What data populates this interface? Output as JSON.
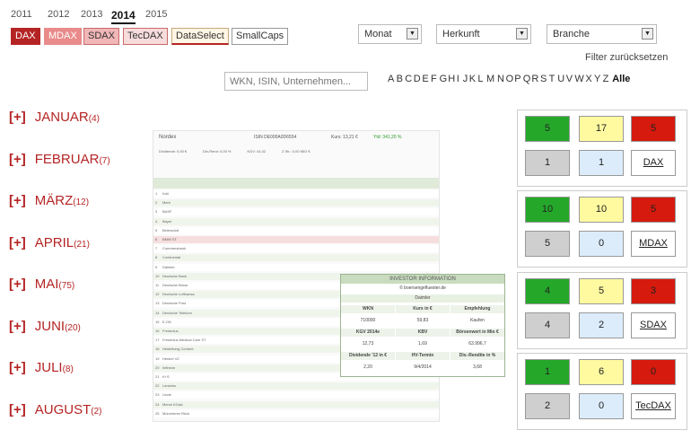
{
  "years": [
    "2011",
    "2012",
    "2013",
    "2014",
    "2015"
  ],
  "active_year": "2014",
  "indices": [
    {
      "label": "DAX",
      "bg": "#b52424",
      "fg": "#ffffff",
      "border": "#b52424"
    },
    {
      "label": "MDAX",
      "bg": "#e98b8b",
      "fg": "#ffffff",
      "border": "#e98b8b"
    },
    {
      "label": "SDAX",
      "bg": "#f1b6b6",
      "fg": "#333333",
      "border": "#c86a6a"
    },
    {
      "label": "TecDAX",
      "bg": "#f8dcdc",
      "fg": "#333333",
      "border": "#c86a6a"
    },
    {
      "label": "DataSelect",
      "bg": "#fff6e5",
      "fg": "#333333",
      "border": "#c9a77a"
    },
    {
      "label": "SmallCaps",
      "bg": "#ffffff",
      "fg": "#333333",
      "border": "#999999"
    }
  ],
  "filters": {
    "monat": "Monat",
    "herkunft": "Herkunft",
    "branche": "Branche",
    "reset": "Filter zurücksetzen",
    "search_placeholder": "WKN, ISIN, Unternehmen...",
    "letters": [
      "A",
      "B",
      "C",
      "D",
      "E",
      "F",
      "G",
      "H",
      "I",
      "J",
      "K",
      "L",
      "M",
      "N",
      "O",
      "P",
      "Q",
      "R",
      "S",
      "T",
      "U",
      "V",
      "W",
      "X",
      "Y",
      "Z"
    ],
    "all_label": "Alle"
  },
  "months": [
    {
      "plus": "[+]",
      "name": "JANUAR",
      "count": "(4)"
    },
    {
      "plus": "[+]",
      "name": "FEBRUAR",
      "count": "(7)"
    },
    {
      "plus": "[+]",
      "name": "MÄRZ",
      "count": "(12)"
    },
    {
      "plus": "[+]",
      "name": "APRIL",
      "count": "(21)"
    },
    {
      "plus": "[+]",
      "name": "MAI",
      "count": "(75)"
    },
    {
      "plus": "[+]",
      "name": "JUNI",
      "count": "(20)"
    },
    {
      "plus": "[+]",
      "name": "JULI",
      "count": "(8)"
    },
    {
      "plus": "[+]",
      "name": "AUGUST",
      "count": "(2)"
    }
  ],
  "panels": [
    {
      "green": "5",
      "yellow": "17",
      "red": "5",
      "gray": "1",
      "blue": "1",
      "label": "DAX"
    },
    {
      "green": "10",
      "yellow": "10",
      "red": "5",
      "gray": "5",
      "blue": "0",
      "label": "MDAX"
    },
    {
      "green": "4",
      "yellow": "5",
      "red": "3",
      "gray": "4",
      "blue": "2",
      "label": "SDAX"
    },
    {
      "green": "1",
      "yellow": "6",
      "red": "0",
      "gray": "2",
      "blue": "0",
      "label": "TecDAX"
    }
  ],
  "colors": {
    "green": "#25a82a",
    "yellow": "#fffaa0",
    "red": "#d61a0e",
    "gray": "#cfcfcf",
    "blue": "#dcecfb",
    "accent": "#b52424"
  },
  "preview": {
    "company": "Nordex",
    "isin": "ISIN DE000A0D6554",
    "kurs": "Kurs: 13,21 €",
    "ytd": "Ytd: 341,20 %",
    "stats": [
      "Dividende: 0,00 €",
      "Div-Rend: 0,00 %",
      "KGV: 44,02",
      "Z Str.: 0,00 MIO €"
    ],
    "rows": [
      "Kali",
      "Merk",
      "BASF",
      "Bayer",
      "Beiersdorf",
      "BMW ST",
      "Commerzbank",
      "Continental",
      "Daimler",
      "Deutsche Bank",
      "Deutsche Börse",
      "Deutsche Lufthansa",
      "Deutsche Post",
      "Deutsche Telekom",
      "E.ON",
      "Fresenius",
      "Fresenius Medical Care ST",
      "Heidelberg Cement",
      "Henkel VZ",
      "Infineon",
      "K+S",
      "Lanxess",
      "Linde",
      "Merck KGaA",
      "Münchener Rück"
    ]
  },
  "card": {
    "title": "INVESTOR INFORMATION",
    "sub": "© boersengefluester.de",
    "company": "Daimler",
    "rows": [
      [
        "WKN",
        "Kurs in €",
        "Empfehlung"
      ],
      [
        "710000",
        "59,83",
        "Kaufen"
      ],
      [
        "KGV 2014e",
        "KBV",
        "Börsenwert in Mio €"
      ],
      [
        "12,73",
        "1,69",
        "63.996,7"
      ],
      [
        "Dividende '12 in €",
        "HV-Termin",
        "Div.-Rendite in %"
      ],
      [
        "2,20",
        "9/4/2014",
        "3,68"
      ]
    ]
  }
}
